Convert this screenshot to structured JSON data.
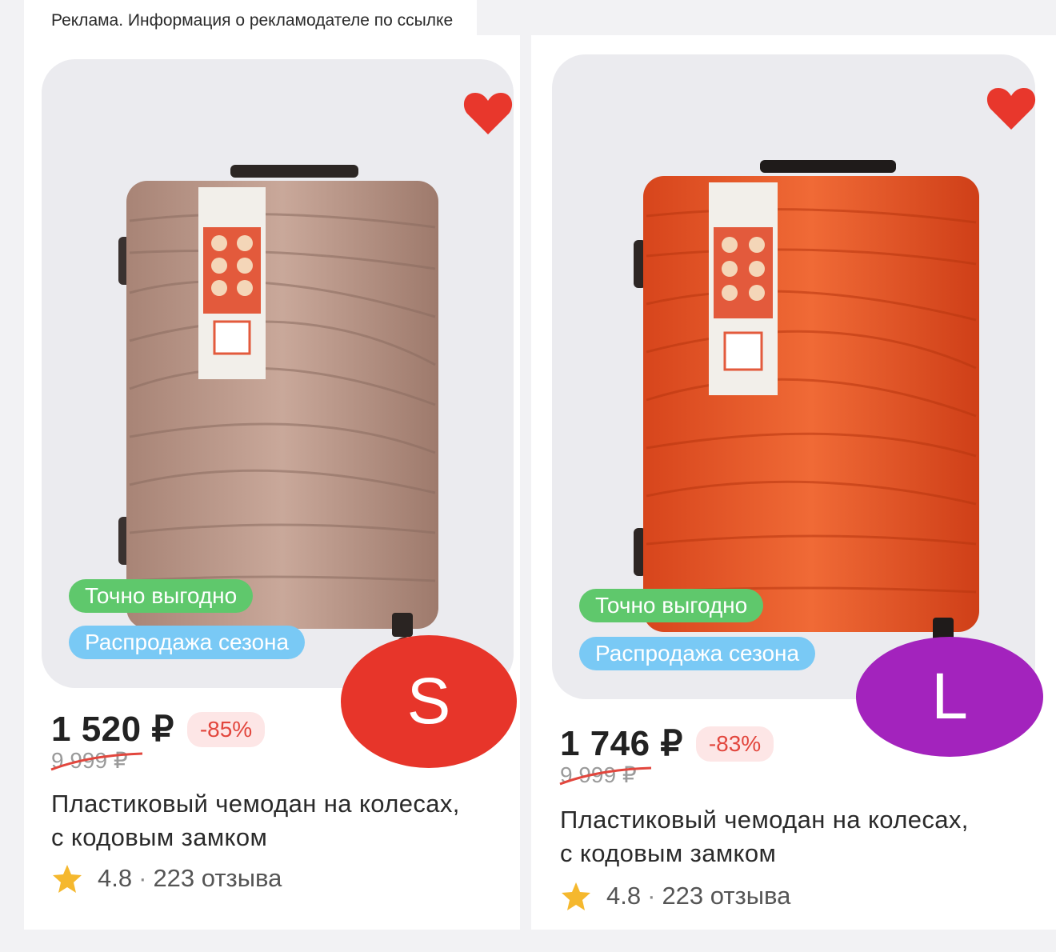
{
  "ad_notice": "Реклама. Информация о рекламодателе по ссылке",
  "colors": {
    "favorite": "#e8372c",
    "badge_good_deal": "#5fc86c",
    "badge_sale": "#79c9f5",
    "size_s": "#e7352a",
    "size_l": "#a323bd",
    "discount_text": "#e2463d"
  },
  "products": [
    {
      "suitcase_color": "rosegold",
      "favorite_icon": "heart-icon",
      "badges": [
        "Точно выгодно",
        "Распродажа сезона"
      ],
      "size": "S",
      "price": "1 520 ₽",
      "discount": "-85%",
      "old_price": "9 999 ₽",
      "title": "Пластиковый чемодан на колесах, с кодовым замком",
      "rating": "4.8",
      "reviews": "223 отзыва"
    },
    {
      "suitcase_color": "orange",
      "favorite_icon": "heart-icon",
      "badges": [
        "Точно выгодно",
        "Распродажа сезона"
      ],
      "size": "L",
      "price": "1 746 ₽",
      "discount": "-83%",
      "old_price": "9 999 ₽",
      "title": "Пластиковый чемодан на колесах, с кодовым замком",
      "rating": "4.8",
      "reviews": "223 отзыва"
    }
  ]
}
